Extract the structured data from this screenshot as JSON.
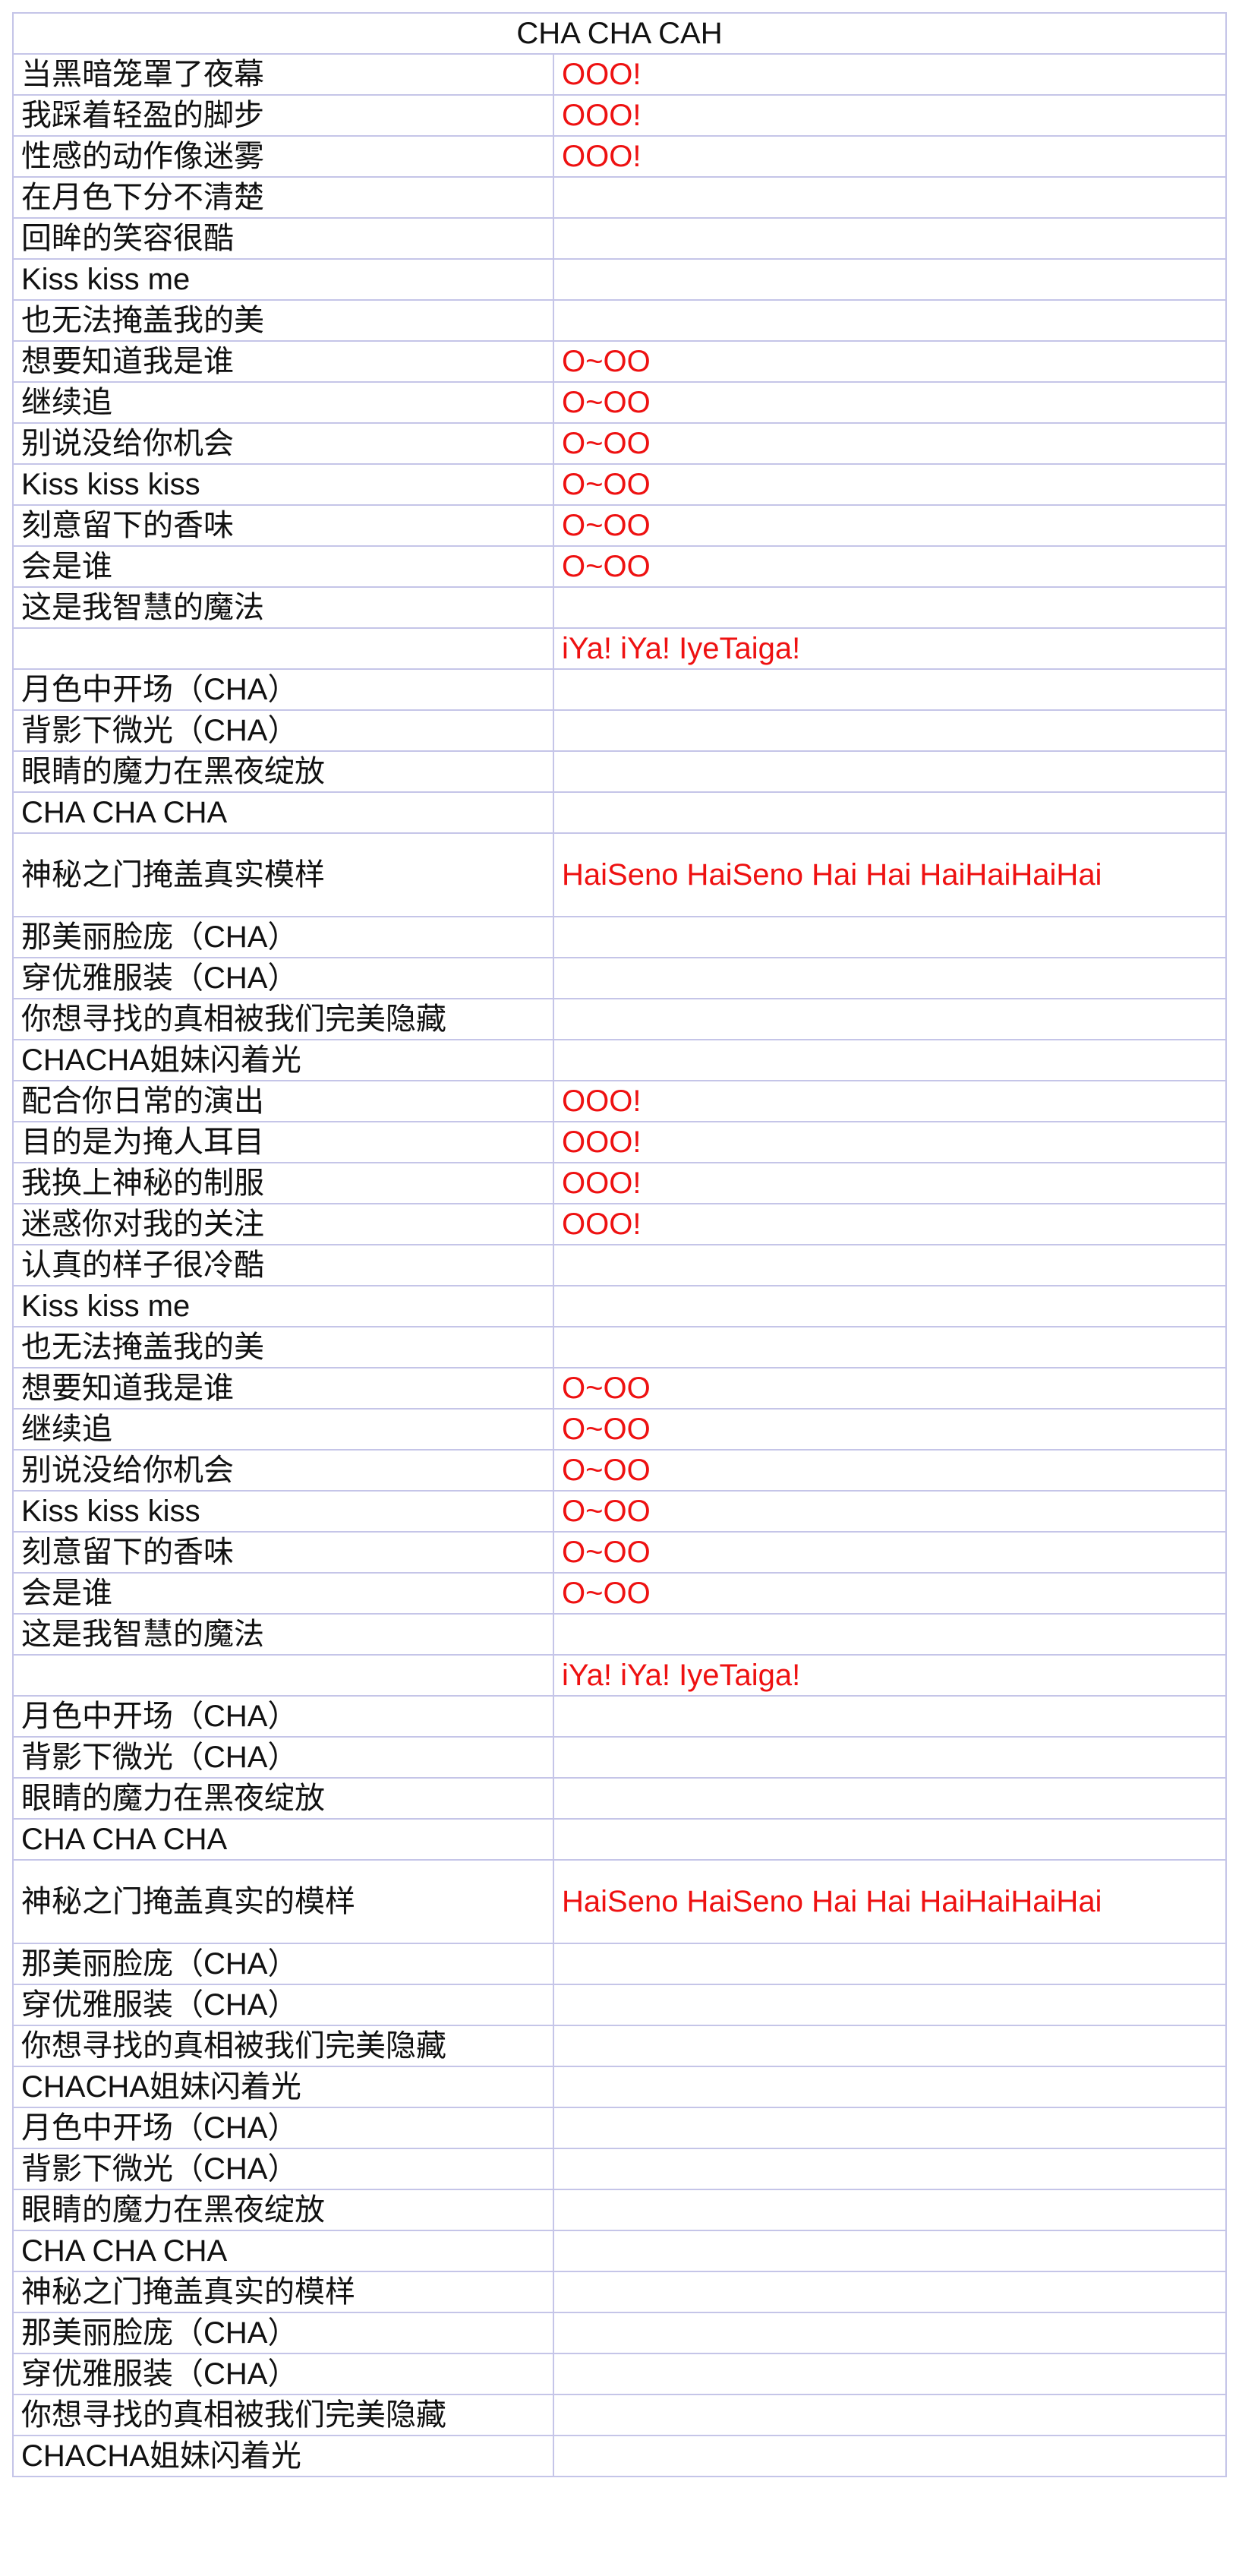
{
  "title": "CHA CHA CAH",
  "colors": {
    "grid": "#c5c5e8",
    "text": "#111111",
    "accent": "#ee1111"
  },
  "rows": [
    {
      "left": "当黑暗笼罩了夜幕",
      "right": "OOO!"
    },
    {
      "left": "我踩着轻盈的脚步",
      "right": "OOO!"
    },
    {
      "left": "性感的动作像迷雾",
      "right": "OOO!"
    },
    {
      "left": "在月色下分不清楚",
      "right": ""
    },
    {
      "left": "回眸的笑容很酷",
      "right": ""
    },
    {
      "left": "Kiss kiss me",
      "right": ""
    },
    {
      "left": "也无法掩盖我的美",
      "right": ""
    },
    {
      "left": "想要知道我是谁",
      "right": "O~OO"
    },
    {
      "left": "继续追",
      "right": "O~OO"
    },
    {
      "left": "别说没给你机会",
      "right": "O~OO"
    },
    {
      "left": "Kiss kiss kiss",
      "right": "O~OO"
    },
    {
      "left": "刻意留下的香味",
      "right": "O~OO"
    },
    {
      "left": "会是谁",
      "right": "O~OO"
    },
    {
      "left": "这是我智慧的魔法",
      "right": ""
    },
    {
      "left": "",
      "right": "iYa!  iYa!  IyeTaiga!"
    },
    {
      "left": "月色中开场（CHA）",
      "right": ""
    },
    {
      "left": "背影下微光（CHA）",
      "right": ""
    },
    {
      "left": "眼睛的魔力在黑夜绽放",
      "right": ""
    },
    {
      "left": "CHA CHA CHA",
      "right": ""
    },
    {
      "left": "神秘之门掩盖真实模样",
      "right": "HaiSeno HaiSeno\nHai Hai HaiHaiHaiHai"
    },
    {
      "left": "那美丽脸庞（CHA）",
      "right": ""
    },
    {
      "left": "穿优雅服装（CHA）",
      "right": ""
    },
    {
      "left": "你想寻找的真相被我们完美隐藏",
      "right": ""
    },
    {
      "left": "CHACHA姐妹闪着光",
      "right": ""
    },
    {
      "left": "配合你日常的演出",
      "right": "OOO!"
    },
    {
      "left": "目的是为掩人耳目",
      "right": "OOO!"
    },
    {
      "left": "我换上神秘的制服",
      "right": "OOO!"
    },
    {
      "left": "迷惑你对我的关注",
      "right": "OOO!"
    },
    {
      "left": "认真的样子很冷酷",
      "right": ""
    },
    {
      "left": "Kiss kiss me",
      "right": ""
    },
    {
      "left": "也无法掩盖我的美",
      "right": ""
    },
    {
      "left": "想要知道我是谁",
      "right": "O~OO"
    },
    {
      "left": "继续追",
      "right": "O~OO"
    },
    {
      "left": "别说没给你机会",
      "right": "O~OO"
    },
    {
      "left": "Kiss kiss kiss",
      "right": "O~OO"
    },
    {
      "left": "刻意留下的香味",
      "right": "O~OO"
    },
    {
      "left": "会是谁",
      "right": "O~OO"
    },
    {
      "left": "这是我智慧的魔法",
      "right": ""
    },
    {
      "left": "",
      "right": "iYa!  iYa!  IyeTaiga!"
    },
    {
      "left": "月色中开场（CHA）",
      "right": ""
    },
    {
      "left": "背影下微光（CHA）",
      "right": ""
    },
    {
      "left": "眼睛的魔力在黑夜绽放",
      "right": ""
    },
    {
      "left": "CHA CHA CHA",
      "right": ""
    },
    {
      "left": "神秘之门掩盖真实的模样",
      "right": "HaiSeno HaiSeno\nHai Hai HaiHaiHaiHai"
    },
    {
      "left": "那美丽脸庞（CHA）",
      "right": ""
    },
    {
      "left": "穿优雅服装（CHA）",
      "right": ""
    },
    {
      "left": "你想寻找的真相被我们完美隐藏",
      "right": ""
    },
    {
      "left": "CHACHA姐妹闪着光",
      "right": ""
    },
    {
      "left": "月色中开场（CHA）",
      "right": ""
    },
    {
      "left": "背影下微光（CHA）",
      "right": ""
    },
    {
      "left": "眼睛的魔力在黑夜绽放",
      "right": ""
    },
    {
      "left": "CHA CHA CHA",
      "right": ""
    },
    {
      "left": "神秘之门掩盖真实的模样",
      "right": ""
    },
    {
      "left": "那美丽脸庞（CHA）",
      "right": ""
    },
    {
      "left": "穿优雅服装（CHA）",
      "right": ""
    },
    {
      "left": "你想寻找的真相被我们完美隐藏",
      "right": ""
    },
    {
      "left": "CHACHA姐妹闪着光",
      "right": ""
    }
  ]
}
